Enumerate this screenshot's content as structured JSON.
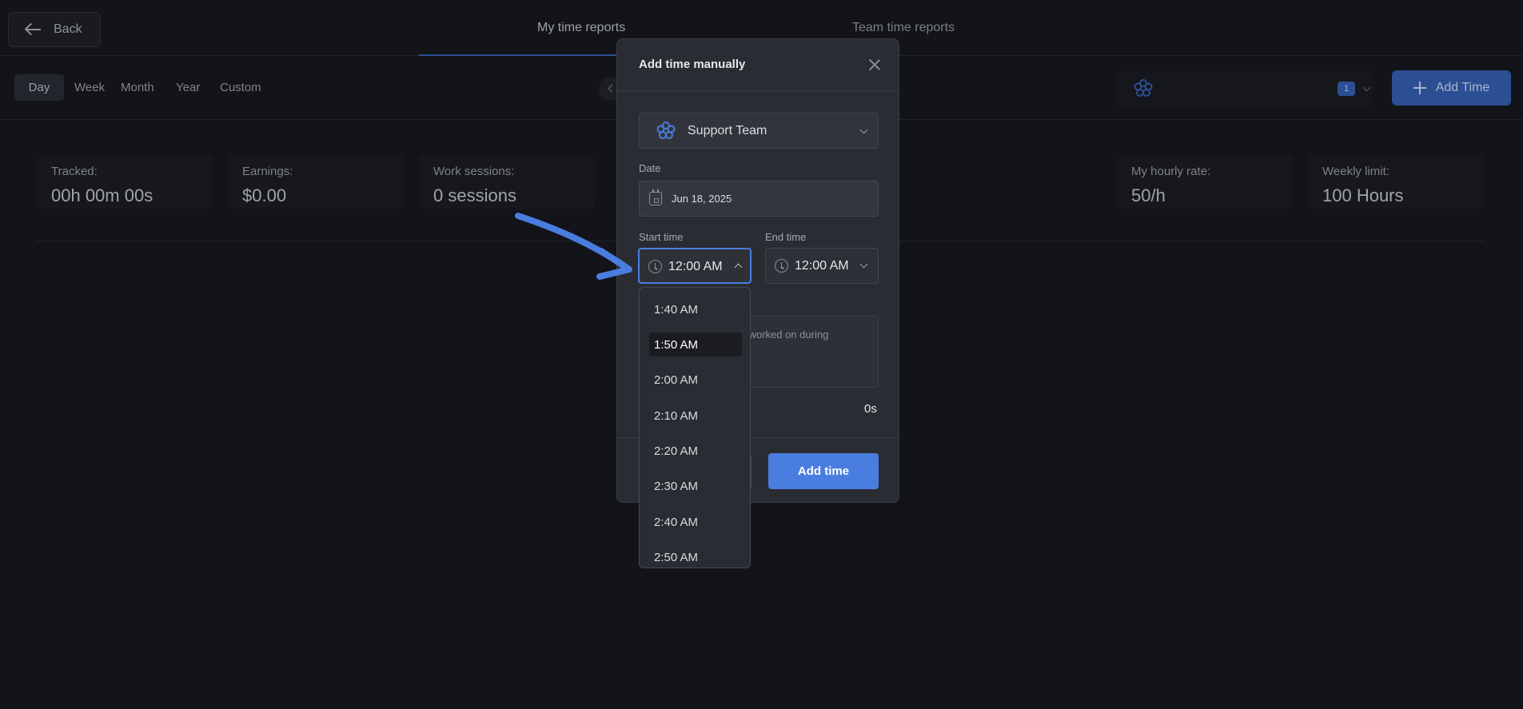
{
  "header": {
    "back_label": "Back",
    "tabs": [
      {
        "label": "My time reports",
        "active": true
      },
      {
        "label": "Team time reports",
        "active": false
      }
    ]
  },
  "period_tabs": [
    "Day",
    "Week",
    "Month",
    "Year",
    "Custom"
  ],
  "org_selector": {
    "badge": "1",
    "icon": "flower-logo-icon"
  },
  "add_time_button": "Add Time",
  "stats": [
    {
      "label": "Tracked:",
      "value": "00h 00m 00s"
    },
    {
      "label": "Earnings:",
      "value": "$0.00"
    },
    {
      "label": "Work sessions:",
      "value": "0 sessions"
    },
    {
      "label": "My hourly rate:",
      "value": "50/h"
    },
    {
      "label": "Weekly limit:",
      "value": "100 Hours"
    }
  ],
  "modal": {
    "title": "Add time manually",
    "team": "Support Team",
    "date_label": "Date",
    "date_value": "Jun 18, 2025",
    "start_label": "Start time",
    "start_value": "12:00 AM",
    "end_label": "End time",
    "end_value": "12:00 AM",
    "description_placeholder": "you worked on during",
    "duration": "0s",
    "submit_label": "Add time"
  },
  "time_dropdown": {
    "options": [
      "1:40 AM",
      "1:50 AM",
      "2:00 AM",
      "2:10 AM",
      "2:20 AM",
      "2:30 AM",
      "2:40 AM",
      "2:50 AM"
    ],
    "selected": "1:50 AM"
  },
  "colors": {
    "accent": "#4a7de0",
    "annotation_arrow": "#4a7de0",
    "background": "#131419",
    "modal": "#2a2c33"
  }
}
